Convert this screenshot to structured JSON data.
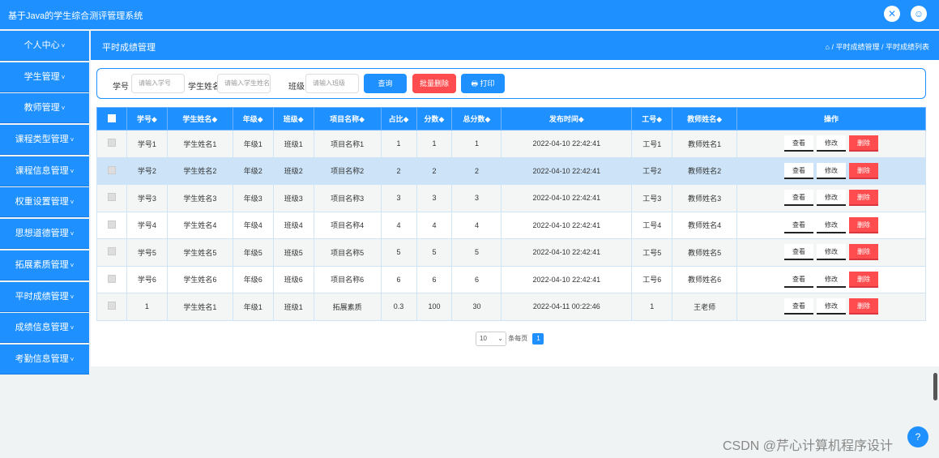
{
  "app_title": "基于Java的学生综合测评管理系统",
  "sidebar": {
    "items": [
      {
        "label": "个人中心"
      },
      {
        "label": "学生管理"
      },
      {
        "label": "教师管理"
      },
      {
        "label": "课程类型管理"
      },
      {
        "label": "课程信息管理"
      },
      {
        "label": "权重设置管理"
      },
      {
        "label": "思想道德管理"
      },
      {
        "label": "拓展素质管理"
      },
      {
        "label": "平时成绩管理"
      },
      {
        "label": "成绩信息管理"
      },
      {
        "label": "考勤信息管理"
      }
    ],
    "arrow": "˅"
  },
  "crumb": {
    "page_title": "平时成绩管理",
    "home_icon": "⌂",
    "path": "/ 平时成绩管理 / 平时成绩列表"
  },
  "search": {
    "field1_label": "学号",
    "field1_placeholder": "请输入学号",
    "field2_label": "学生姓名",
    "field2_placeholder": "请输入学生姓名",
    "field3_label": "班级",
    "field3_placeholder": "请输入班级",
    "query_label": "查询",
    "batch_delete_label": "批量删除",
    "print_label": "🖶 打印"
  },
  "table": {
    "headers": [
      "学号◆",
      "学生姓名◆",
      "年级◆",
      "班级◆",
      "项目名称◆",
      "占比◆",
      "分数◆",
      "总分数◆",
      "发布时间◆",
      "工号◆",
      "教师姓名◆",
      "操作"
    ],
    "rows": [
      [
        "学号1",
        "学生姓名1",
        "年级1",
        "班级1",
        "项目名称1",
        "1",
        "1",
        "1",
        "2022-04-10 22:42:41",
        "工号1",
        "教师姓名1"
      ],
      [
        "学号2",
        "学生姓名2",
        "年级2",
        "班级2",
        "项目名称2",
        "2",
        "2",
        "2",
        "2022-04-10 22:42:41",
        "工号2",
        "教师姓名2"
      ],
      [
        "学号3",
        "学生姓名3",
        "年级3",
        "班级3",
        "项目名称3",
        "3",
        "3",
        "3",
        "2022-04-10 22:42:41",
        "工号3",
        "教师姓名3"
      ],
      [
        "学号4",
        "学生姓名4",
        "年级4",
        "班级4",
        "项目名称4",
        "4",
        "4",
        "4",
        "2022-04-10 22:42:41",
        "工号4",
        "教师姓名4"
      ],
      [
        "学号5",
        "学生姓名5",
        "年级5",
        "班级5",
        "项目名称5",
        "5",
        "5",
        "5",
        "2022-04-10 22:42:41",
        "工号5",
        "教师姓名5"
      ],
      [
        "学号6",
        "学生姓名6",
        "年级6",
        "班级6",
        "项目名称6",
        "6",
        "6",
        "6",
        "2022-04-10 22:42:41",
        "工号6",
        "教师姓名6"
      ],
      [
        "1",
        "学生姓名1",
        "年级1",
        "班级1",
        "拓展素质",
        "0.3",
        "100",
        "30",
        "2022-04-11 00:22:46",
        "1",
        "王老师"
      ]
    ],
    "ops": {
      "view": "查看",
      "edit": "修改",
      "delete": "删除"
    }
  },
  "pager": {
    "page_size": "10",
    "suffix": "条每页",
    "current": "1"
  },
  "watermark": "CSDN @芹心计算机程序设计",
  "help_icon": "?"
}
